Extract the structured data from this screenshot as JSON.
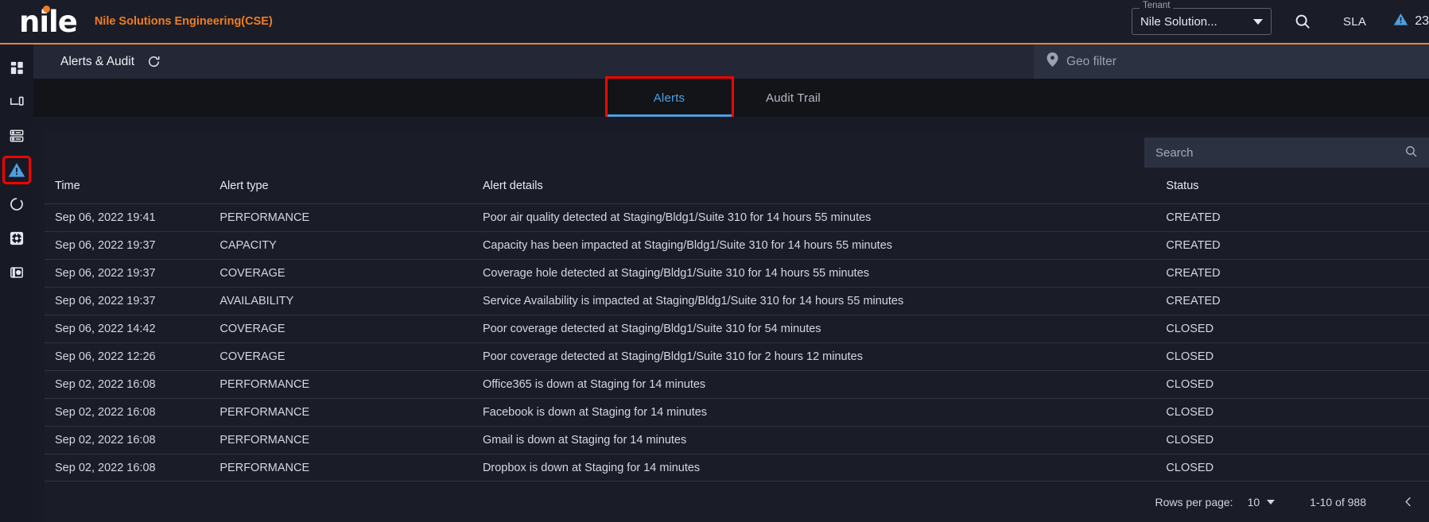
{
  "header": {
    "logo_text": "nile",
    "org_name": "Nile Solutions Engineering(CSE)",
    "tenant_label": "Tenant",
    "tenant_value": "Nile Solution...",
    "search_icon": "search-icon",
    "sla_label": "SLA",
    "alert_badge_icon": "warning-triangle-icon",
    "alert_badge_count": "23",
    "accent_color": "#e8863a",
    "brand_orange": "#f07d22"
  },
  "sidebar": {
    "items": [
      {
        "name": "dashboard",
        "icon": "dashboard-grid-icon",
        "active": false
      },
      {
        "name": "clients",
        "icon": "monitor-device-icon",
        "active": false
      },
      {
        "name": "inventory",
        "icon": "server-rack-icon",
        "active": false
      },
      {
        "name": "alerts",
        "icon": "alert-triangle-icon",
        "active": true
      },
      {
        "name": "operations",
        "icon": "circle-arrow-icon",
        "active": false
      },
      {
        "name": "settings",
        "icon": "gear-icon",
        "active": false
      },
      {
        "name": "subscription",
        "icon": "card-wallet-icon",
        "active": false
      }
    ]
  },
  "pagebar": {
    "title": "Alerts & Audit",
    "refresh_icon": "refresh-icon",
    "geo_filter_icon": "map-pin-icon",
    "geo_filter_placeholder": "Geo filter"
  },
  "tabs": [
    {
      "label": "Alerts",
      "active": true,
      "highlighted": true
    },
    {
      "label": "Audit Trail",
      "active": false,
      "highlighted": false
    }
  ],
  "search": {
    "placeholder": "Search",
    "value": "",
    "icon": "search-icon"
  },
  "table": {
    "columns": [
      "Time",
      "Alert type",
      "Alert details",
      "Status"
    ],
    "rows": [
      {
        "time": "Sep 06, 2022 19:41",
        "type": "PERFORMANCE",
        "details": "Poor air quality detected at Staging/Bldg1/Suite 310 for 14 hours 55 minutes",
        "status": "CREATED"
      },
      {
        "time": "Sep 06, 2022 19:37",
        "type": "CAPACITY",
        "details": "Capacity has been impacted at Staging/Bldg1/Suite 310 for 14 hours 55 minutes",
        "status": "CREATED"
      },
      {
        "time": "Sep 06, 2022 19:37",
        "type": "COVERAGE",
        "details": "Coverage hole detected at Staging/Bldg1/Suite 310 for 14 hours 55 minutes",
        "status": "CREATED"
      },
      {
        "time": "Sep 06, 2022 19:37",
        "type": "AVAILABILITY",
        "details": "Service Availability is impacted at Staging/Bldg1/Suite 310 for 14 hours 55 minutes",
        "status": "CREATED"
      },
      {
        "time": "Sep 06, 2022 14:42",
        "type": "COVERAGE",
        "details": "Poor coverage detected at Staging/Bldg1/Suite 310 for 54 minutes",
        "status": "CLOSED"
      },
      {
        "time": "Sep 06, 2022 12:26",
        "type": "COVERAGE",
        "details": "Poor coverage detected at Staging/Bldg1/Suite 310 for 2 hours 12 minutes",
        "status": "CLOSED"
      },
      {
        "time": "Sep 02, 2022 16:08",
        "type": "PERFORMANCE",
        "details": "Office365 is down at Staging for 14 minutes",
        "status": "CLOSED"
      },
      {
        "time": "Sep 02, 2022 16:08",
        "type": "PERFORMANCE",
        "details": "Facebook is down at Staging for 14 minutes",
        "status": "CLOSED"
      },
      {
        "time": "Sep 02, 2022 16:08",
        "type": "PERFORMANCE",
        "details": "Gmail is down at Staging for 14 minutes",
        "status": "CLOSED"
      },
      {
        "time": "Sep 02, 2022 16:08",
        "type": "PERFORMANCE",
        "details": "Dropbox is down at Staging for 14 minutes",
        "status": "CLOSED"
      }
    ]
  },
  "pagination": {
    "rows_per_page_label": "Rows per page:",
    "rows_per_page_value": "10",
    "range_text": "1-10 of 988",
    "prev_icon": "chevron-left-icon"
  }
}
